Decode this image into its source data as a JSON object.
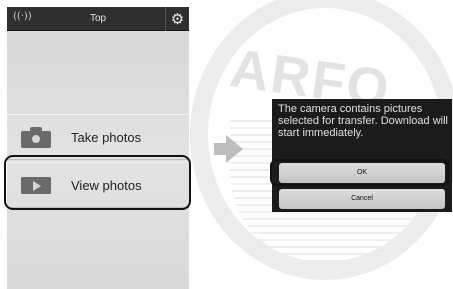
{
  "phone": {
    "title": "Top",
    "wifi_icon": "((·))",
    "gear_icon": "⚙",
    "menu": [
      {
        "label": "Take photos",
        "icon": "camera-icon"
      },
      {
        "label": "View photos",
        "icon": "play-icon"
      }
    ]
  },
  "dialog": {
    "message": "The camera contains pictures selected for transfer. Download will start immediately.",
    "ok_label": "OK",
    "cancel_label": "Cancel"
  },
  "watermark": {
    "letters": "ARFO"
  },
  "colors": {
    "status_bar": "#2f2f2f",
    "screen_bg": "#dcdcdc",
    "dialog_bg": "#1b1b1b",
    "button_bg": "#d2d2d2",
    "highlight": "#111111"
  }
}
